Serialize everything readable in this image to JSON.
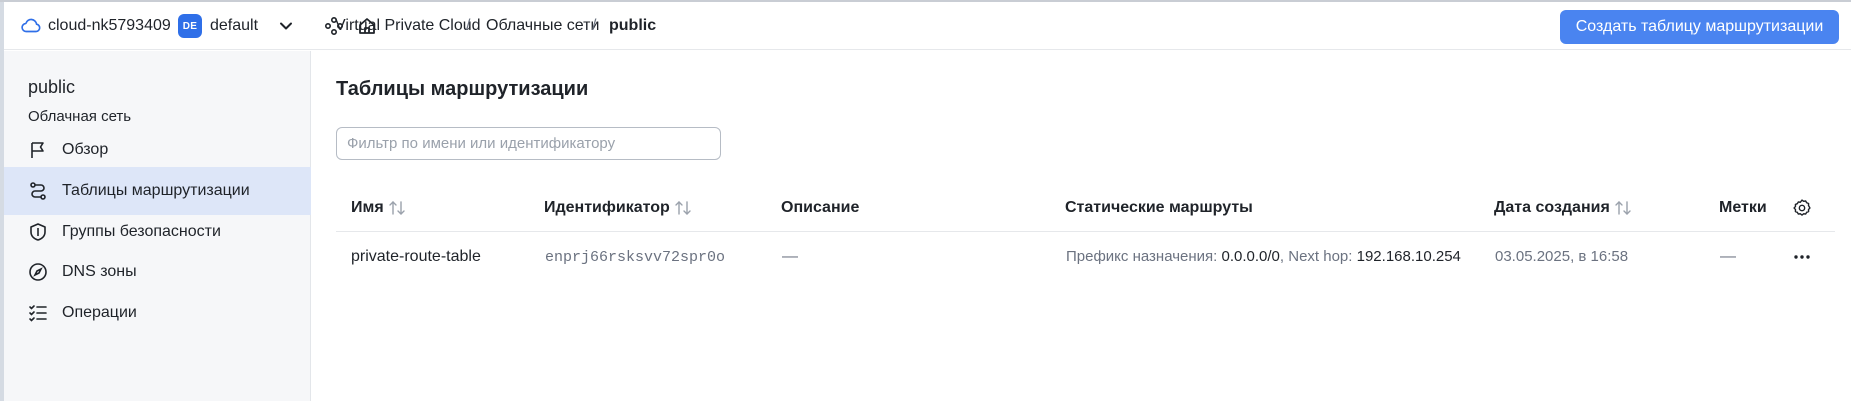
{
  "header": {
    "cloud_name": "cloud-nk5793409",
    "folder_badge": "DE",
    "folder_name": "default",
    "breadcrumbs": [
      {
        "label": "Virtual Private Cloud"
      },
      {
        "label": "Облачные сети"
      },
      {
        "label": "public"
      }
    ],
    "separator": "/",
    "create_button": "Создать таблицу маршрутизации"
  },
  "sidebar": {
    "title": "public",
    "subtitle": "Облачная сеть",
    "items": [
      {
        "label": "Обзор",
        "icon": "flag-icon"
      },
      {
        "label": "Таблицы маршрутизации",
        "icon": "route-icon",
        "active": true
      },
      {
        "label": "Группы безопасности",
        "icon": "shield-icon"
      },
      {
        "label": "DNS зоны",
        "icon": "compass-icon"
      },
      {
        "label": "Операции",
        "icon": "list-check-icon"
      }
    ]
  },
  "main": {
    "title": "Таблицы маршрутизации",
    "filter_placeholder": "Фильтр по имени или идентификатору",
    "columns": [
      "Имя",
      "Идентификатор",
      "Описание",
      "Статические маршруты",
      "Дата создания",
      "Метки"
    ],
    "rows": [
      {
        "name": "private-route-table",
        "id": "enprj66rsksvv72spr0o",
        "description": "—",
        "route_prefix_label": "Префикс назначения:",
        "route_prefix": "0.0.0.0/0",
        "route_sep": ",",
        "route_hop_label": "Next hop:",
        "route_hop": "192.168.10.254",
        "created": "03.05.2025, в 16:58",
        "labels": "—"
      }
    ]
  },
  "colors": {
    "accent": "#4a84f0",
    "active_nav": "#dde6f8",
    "sidebar_bg": "#f6f7f9"
  }
}
